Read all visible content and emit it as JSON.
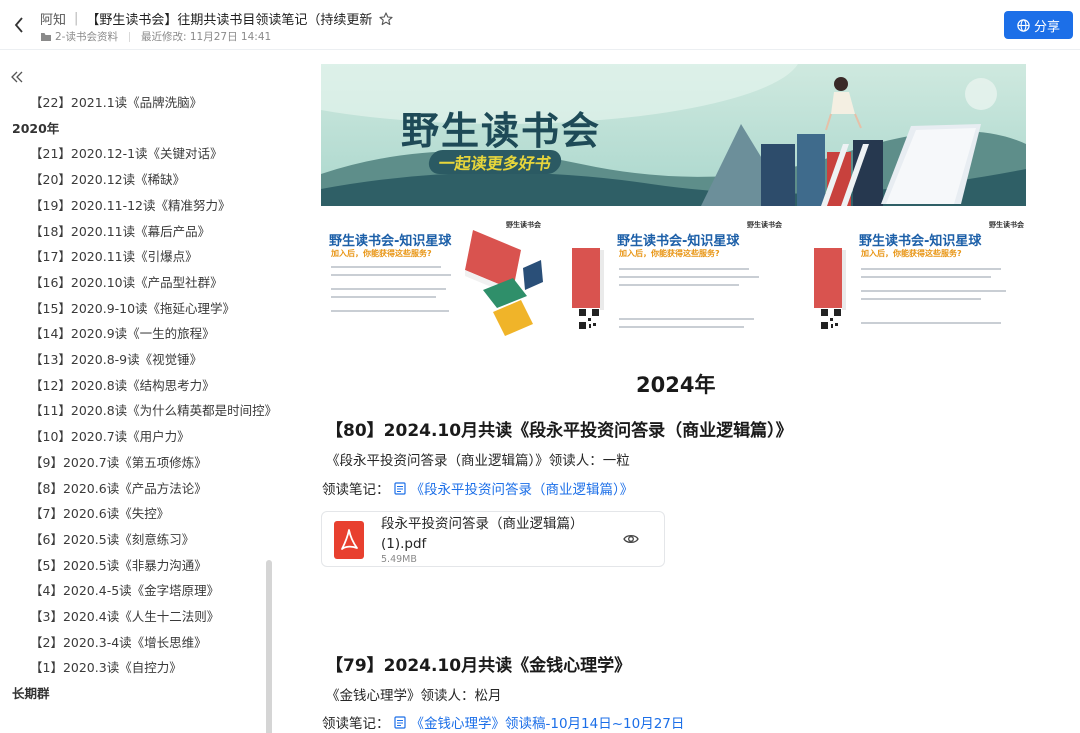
{
  "header": {
    "app_name": "阿知",
    "doc_title": "【野生读书会】往期共读书目领读笔记（持续更新",
    "folder_name": "2-读书会资料",
    "last_modified": "最近修改: 11月27日 14:41",
    "share_label": "分享"
  },
  "sidebar": {
    "items": [
      {
        "label": "【22】2021.1读《品牌洗脑》",
        "type": "item"
      },
      {
        "label": "2020年",
        "type": "heading"
      },
      {
        "label": "【21】2020.12-1读《关键对话》",
        "type": "item"
      },
      {
        "label": "【20】2020.12读《稀缺》",
        "type": "item"
      },
      {
        "label": "【19】2020.11-12读《精准努力》",
        "type": "item"
      },
      {
        "label": "【18】2020.11读《幕后产品》",
        "type": "item"
      },
      {
        "label": "【17】2020.11读《引爆点》",
        "type": "item"
      },
      {
        "label": "【16】2020.10读《产品型社群》",
        "type": "item"
      },
      {
        "label": "【15】2020.9-10读《拖延心理学》",
        "type": "item"
      },
      {
        "label": "【14】2020.9读《一生的旅程》",
        "type": "item"
      },
      {
        "label": "【13】2020.8-9读《视觉锤》",
        "type": "item"
      },
      {
        "label": "【12】2020.8读《结构思考力》",
        "type": "item"
      },
      {
        "label": "【11】2020.8读《为什么精英都是时间控》",
        "type": "item"
      },
      {
        "label": "【10】2020.7读《用户力》",
        "type": "item"
      },
      {
        "label": "【9】2020.7读《第五项修炼》",
        "type": "item"
      },
      {
        "label": "【8】2020.6读《产品方法论》",
        "type": "item"
      },
      {
        "label": "【7】2020.6读《失控》",
        "type": "item"
      },
      {
        "label": "【6】2020.5读《刻意练习》",
        "type": "item"
      },
      {
        "label": "【5】2020.5读《非暴力沟通》",
        "type": "item"
      },
      {
        "label": "【4】2020.4-5读《金字塔原理》",
        "type": "item"
      },
      {
        "label": "【3】2020.4读《人生十二法则》",
        "type": "item"
      },
      {
        "label": "【2】2020.3-4读《增长思维》",
        "type": "item"
      },
      {
        "label": "【1】2020.3读《自控力》",
        "type": "item"
      },
      {
        "label": "长期群",
        "type": "heading"
      }
    ]
  },
  "main": {
    "banner": {
      "title": "野生读书会",
      "subtitle": "一起读更多好书"
    },
    "cards": [
      {
        "title": "野生读书会-知识星球",
        "subtitle": "加入后，你能获得这些服务?",
        "mark": "野生读书会"
      },
      {
        "title": "野生读书会-知识星球",
        "subtitle": "加入后，你能获得这些服务?",
        "mark": "野生读书会"
      },
      {
        "title": "野生读书会-知识星球",
        "subtitle": "加入后，你能获得这些服务?",
        "mark": "野生读书会"
      }
    ],
    "year_heading": "2024年",
    "entries": [
      {
        "title": "【80】2024.10月共读《段永平投资问答录（商业逻辑篇）》",
        "leader": "《段永平投资问答录（商业逻辑篇）》领读人：一粒",
        "notes_label": "领读笔记：",
        "notes_link": "《段永平投资问答录（商业逻辑篇）》"
      },
      {
        "title": "【79】2024.10月共读《金钱心理学》",
        "leader": "《金钱心理学》领读人：松月",
        "notes_label": "领读笔记：",
        "notes_link": "《金钱心理学》领读稿-10月14日~10月27日"
      }
    ],
    "attachment": {
      "file_name": "段永平投资问答录（商业逻辑篇）(1).pdf",
      "file_size": "5.49MB"
    }
  },
  "colors": {
    "accent": "#1c6fe8",
    "pdf_red": "#e8402f",
    "banner_sky": "#b6ddd3"
  }
}
